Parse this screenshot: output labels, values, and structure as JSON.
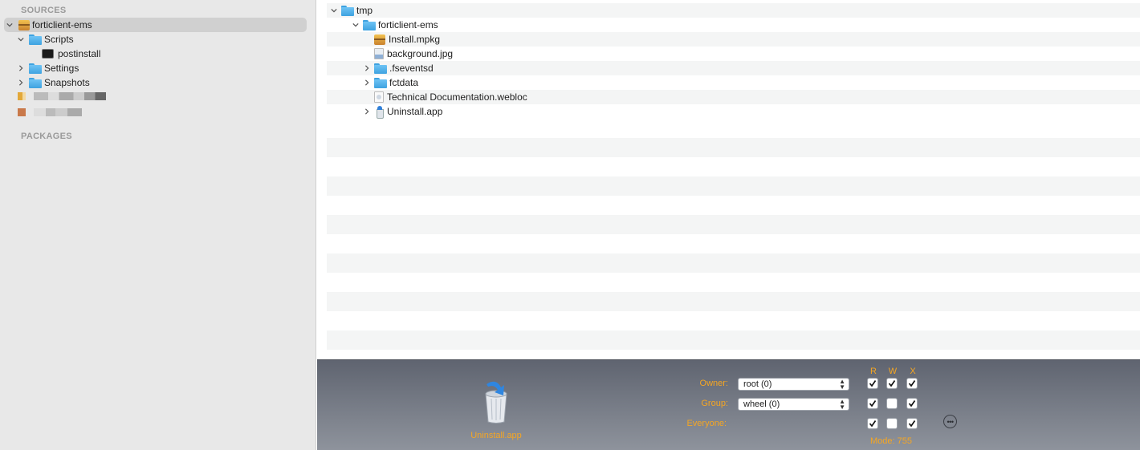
{
  "sidebar": {
    "sources_header": "SOURCES",
    "packages_header": "PACKAGES",
    "items": [
      {
        "label": "forticlient-ems"
      },
      {
        "label": "Scripts"
      },
      {
        "label": "postinstall"
      },
      {
        "label": "Settings"
      },
      {
        "label": "Snapshots"
      }
    ]
  },
  "browser": {
    "rows": [
      {
        "label": "tmp"
      },
      {
        "label": "forticlient-ems"
      },
      {
        "label": "Install.mpkg"
      },
      {
        "label": "background.jpg"
      },
      {
        "label": ".fseventsd"
      },
      {
        "label": "fctdata"
      },
      {
        "label": "Technical Documentation.webloc"
      },
      {
        "label": "Uninstall.app"
      }
    ]
  },
  "inspector": {
    "item_name": "Uninstall.app",
    "owner_label": "Owner:",
    "owner_value": "root (0)",
    "group_label": "Group:",
    "group_value": "wheel (0)",
    "everyone_label": "Everyone:",
    "col_r": "R",
    "col_w": "W",
    "col_x": "X",
    "permissions": {
      "owner": {
        "r": true,
        "w": true,
        "x": true
      },
      "group": {
        "r": true,
        "w": false,
        "x": true
      },
      "everyone": {
        "r": true,
        "w": false,
        "x": true
      }
    },
    "mode": "Mode: 755",
    "accent_color": "#f5a623"
  }
}
